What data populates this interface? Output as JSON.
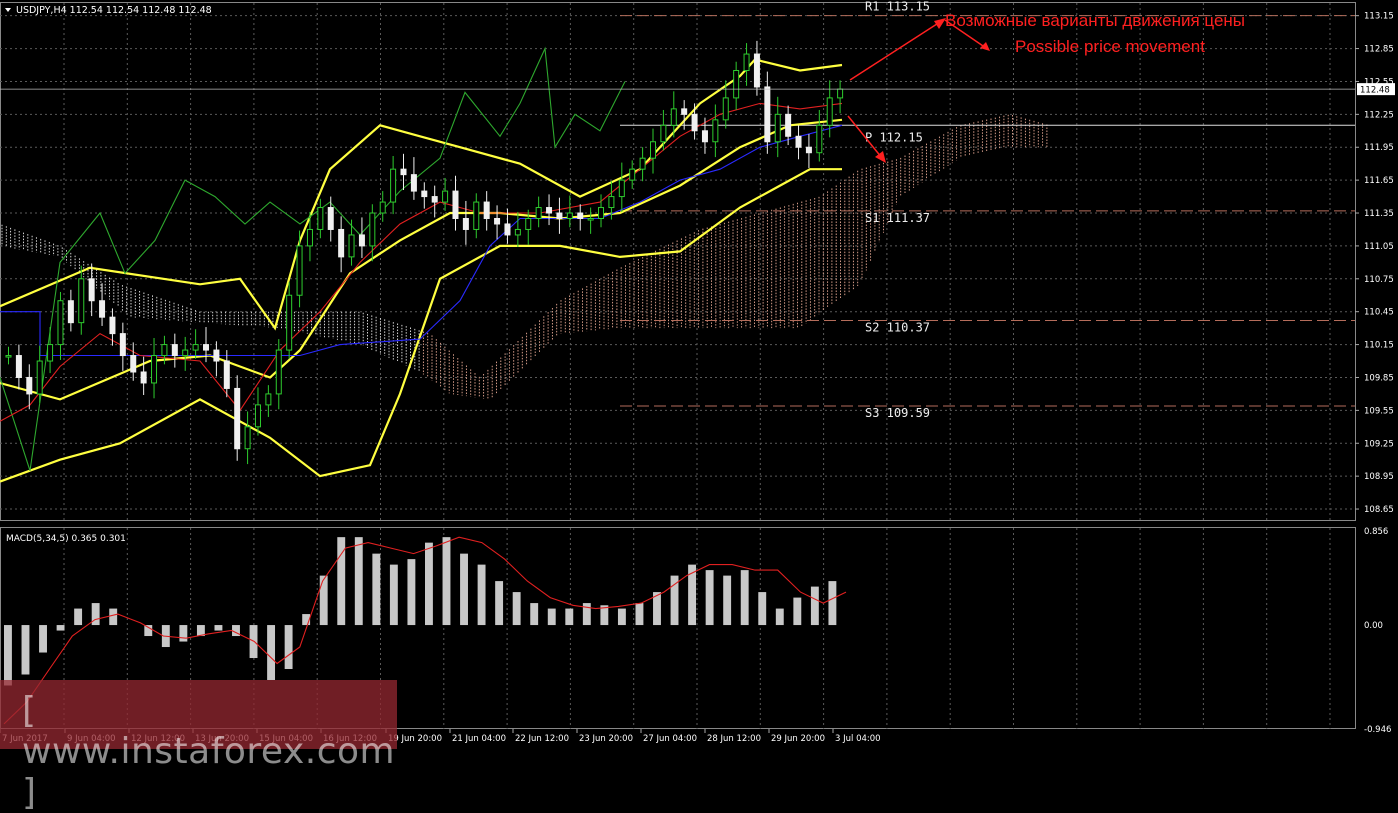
{
  "header": {
    "title": "USDJPY,H4  112.54 112.54 112.48 112.48"
  },
  "annotations": {
    "ru": "Возможные варианты движения цены",
    "en": "Possible price movement",
    "color": "#ff2020"
  },
  "watermark": "[ www.instaforex.com ]",
  "chart_data": [
    {
      "type": "candlestick",
      "title": "USDJPY,H4  112.54 112.54 112.48 112.48",
      "ylim": [
        108.55,
        113.22
      ],
      "y_ticks": [
        "113.15",
        "112.85",
        "112.55",
        "112.25",
        "111.95",
        "111.65",
        "111.35",
        "111.05",
        "110.75",
        "110.45",
        "110.15",
        "109.85",
        "109.55",
        "109.25",
        "108.95",
        "108.65"
      ],
      "current_price": "112.48",
      "x_ticks": [
        "7 Jun 2017",
        "9 Jun 04:00",
        "12 Jun 12:00",
        "13 Jun 20:00",
        "15 Jun 04:00",
        "16 Jun 12:00",
        "19 Jun 20:00",
        "21 Jun 04:00",
        "22 Jun 12:00",
        "23 Jun 20:00",
        "27 Jun 04:00",
        "28 Jun 12:00",
        "29 Jun 20:00",
        "3 Jul 04:00"
      ],
      "pivot_levels": [
        {
          "label": "R1 113.15",
          "value": 113.15
        },
        {
          "label": "P 112.15",
          "value": 112.15
        },
        {
          "label": "S1 111.37",
          "value": 111.37
        },
        {
          "label": "S2 110.37",
          "value": 110.37
        },
        {
          "label": "S3 109.59",
          "value": 109.59
        }
      ],
      "closes": [
        110.05,
        109.85,
        109.7,
        110.0,
        110.15,
        110.55,
        110.35,
        110.75,
        110.55,
        110.4,
        110.25,
        110.05,
        109.9,
        109.8,
        110.05,
        110.15,
        110.05,
        110.1,
        110.15,
        110.1,
        110.0,
        109.75,
        109.2,
        109.4,
        109.6,
        109.7,
        110.1,
        110.6,
        111.05,
        111.2,
        111.4,
        111.2,
        110.95,
        111.15,
        111.05,
        111.35,
        111.45,
        111.75,
        111.7,
        111.55,
        111.5,
        111.45,
        111.55,
        111.3,
        111.2,
        111.45,
        111.3,
        111.25,
        111.15,
        111.2,
        111.3,
        111.4,
        111.35,
        111.3,
        111.35,
        111.3,
        111.3,
        111.4,
        111.5,
        111.65,
        111.75,
        111.85,
        112.0,
        112.15,
        112.3,
        112.25,
        112.1,
        112.0,
        112.2,
        112.4,
        112.65,
        112.8,
        112.5,
        112.0,
        112.25,
        112.05,
        111.95,
        111.9,
        112.15,
        112.4,
        112.48
      ],
      "bollinger": {
        "upper": [
          [
            0,
            110.5
          ],
          [
            90,
            110.85
          ],
          [
            200,
            110.7
          ],
          [
            240,
            110.75
          ],
          [
            275,
            110.3
          ],
          [
            300,
            111.1
          ],
          [
            330,
            111.75
          ],
          [
            380,
            112.15
          ],
          [
            420,
            112.05
          ],
          [
            460,
            111.95
          ],
          [
            520,
            111.8
          ],
          [
            580,
            111.5
          ],
          [
            640,
            111.75
          ],
          [
            700,
            112.35
          ],
          [
            740,
            112.6
          ],
          [
            755,
            112.75
          ],
          [
            800,
            112.65
          ],
          [
            842,
            112.7
          ]
        ],
        "middle": [
          [
            0,
            109.8
          ],
          [
            60,
            109.65
          ],
          [
            150,
            110.0
          ],
          [
            210,
            110.05
          ],
          [
            270,
            109.85
          ],
          [
            300,
            110.1
          ],
          [
            350,
            110.8
          ],
          [
            400,
            111.1
          ],
          [
            450,
            111.35
          ],
          [
            500,
            111.35
          ],
          [
            560,
            111.3
          ],
          [
            620,
            111.35
          ],
          [
            680,
            111.6
          ],
          [
            740,
            111.95
          ],
          [
            790,
            112.15
          ],
          [
            842,
            112.2
          ]
        ],
        "lower": [
          [
            0,
            108.9
          ],
          [
            60,
            109.1
          ],
          [
            120,
            109.25
          ],
          [
            200,
            109.65
          ],
          [
            270,
            109.3
          ],
          [
            320,
            108.95
          ],
          [
            370,
            109.05
          ],
          [
            400,
            109.7
          ],
          [
            440,
            110.75
          ],
          [
            500,
            111.05
          ],
          [
            560,
            111.05
          ],
          [
            620,
            110.95
          ],
          [
            680,
            111.0
          ],
          [
            740,
            111.4
          ],
          [
            780,
            111.6
          ],
          [
            810,
            111.75
          ],
          [
            842,
            111.75
          ]
        ]
      },
      "macd": {
        "label": "MACD(5,34,5) 0.365 0.301",
        "ticks": [
          "0.856",
          "0.00",
          "-0.946"
        ],
        "histogram": [
          -0.55,
          -0.45,
          -0.25,
          -0.05,
          0.15,
          0.2,
          0.15,
          0.0,
          -0.1,
          -0.2,
          -0.15,
          -0.1,
          -0.05,
          -0.1,
          -0.3,
          -0.5,
          -0.4,
          0.1,
          0.45,
          0.8,
          0.8,
          0.65,
          0.55,
          0.6,
          0.75,
          0.8,
          0.65,
          0.55,
          0.4,
          0.3,
          0.2,
          0.15,
          0.15,
          0.2,
          0.18,
          0.15,
          0.2,
          0.3,
          0.45,
          0.55,
          0.5,
          0.45,
          0.5,
          0.3,
          0.15,
          0.25,
          0.35,
          0.4
        ],
        "signal": [
          -0.9,
          -0.7,
          -0.4,
          -0.1,
          0.05,
          0.1,
          0.02,
          -0.1,
          -0.12,
          -0.08,
          -0.05,
          -0.15,
          -0.35,
          -0.2,
          0.4,
          0.7,
          0.75,
          0.7,
          0.65,
          0.72,
          0.8,
          0.75,
          0.6,
          0.4,
          0.25,
          0.18,
          0.15,
          0.17,
          0.2,
          0.3,
          0.45,
          0.55,
          0.55,
          0.5,
          0.5,
          0.3,
          0.2,
          0.3
        ]
      }
    }
  ]
}
